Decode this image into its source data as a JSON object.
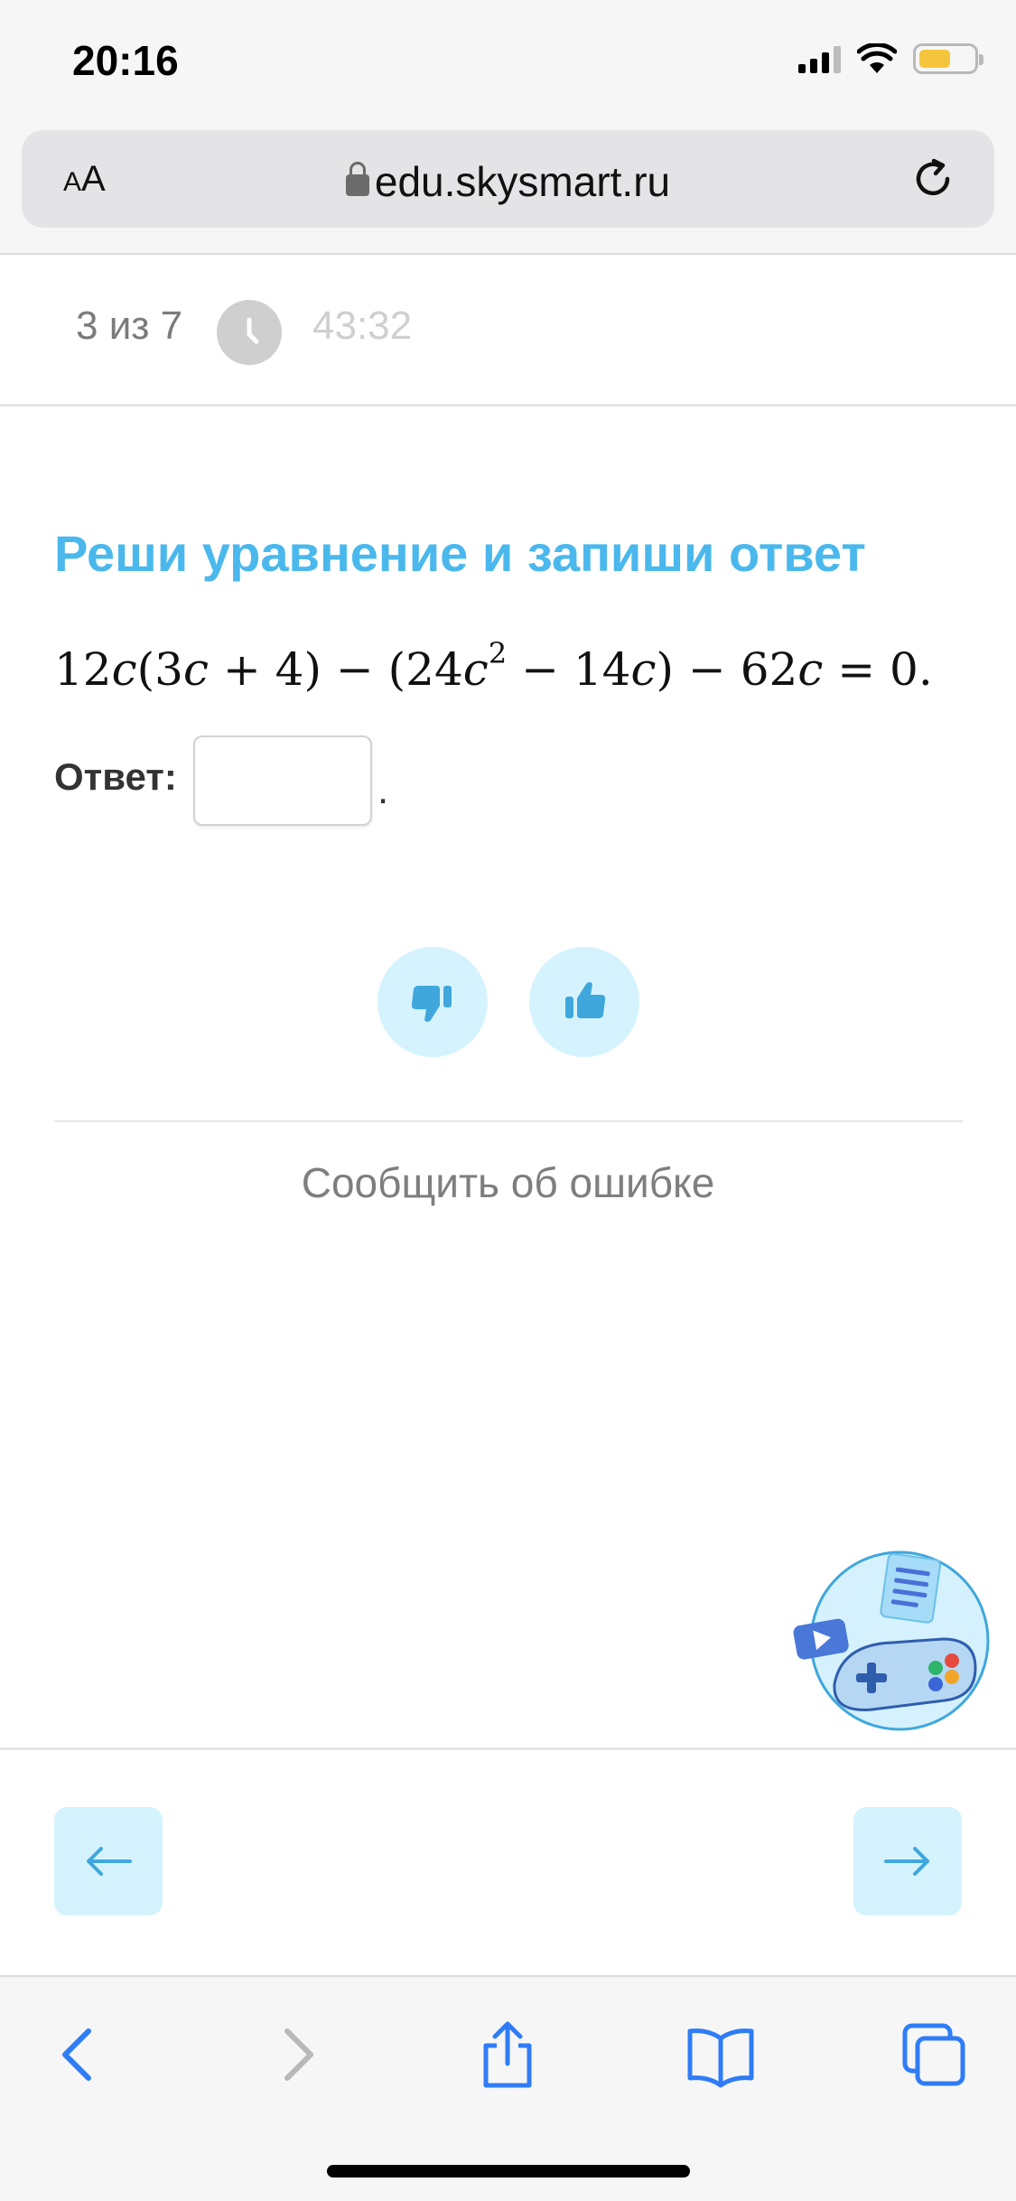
{
  "status_bar": {
    "time": "20:16"
  },
  "browser": {
    "text_size_label_small": "A",
    "text_size_label_large": "A",
    "url": "edu.skysmart.ru"
  },
  "header": {
    "counter": "3 из 7",
    "timer": "43:32"
  },
  "task": {
    "title": "Реши уравнение и запиши ответ",
    "equation": {
      "p1": "12",
      "v1": "c",
      "p2": "(3",
      "v2": "c",
      "p3": " + 4) − (24",
      "v3": "c",
      "exp": "2",
      "p4": " − 14",
      "v4": "c",
      "p5": ") − 62",
      "v5": "c",
      "p6": " = 0."
    },
    "answer_label": "Ответ:",
    "answer_value": "",
    "answer_suffix": "."
  },
  "feedback": {
    "report_link": "Сообщить об ошибке"
  },
  "colors": {
    "accent": "#4ab8ec",
    "button_bg": "#d4f3fe",
    "button_icon": "#3fa7dc",
    "ios_blue": "#2f7cf6"
  }
}
